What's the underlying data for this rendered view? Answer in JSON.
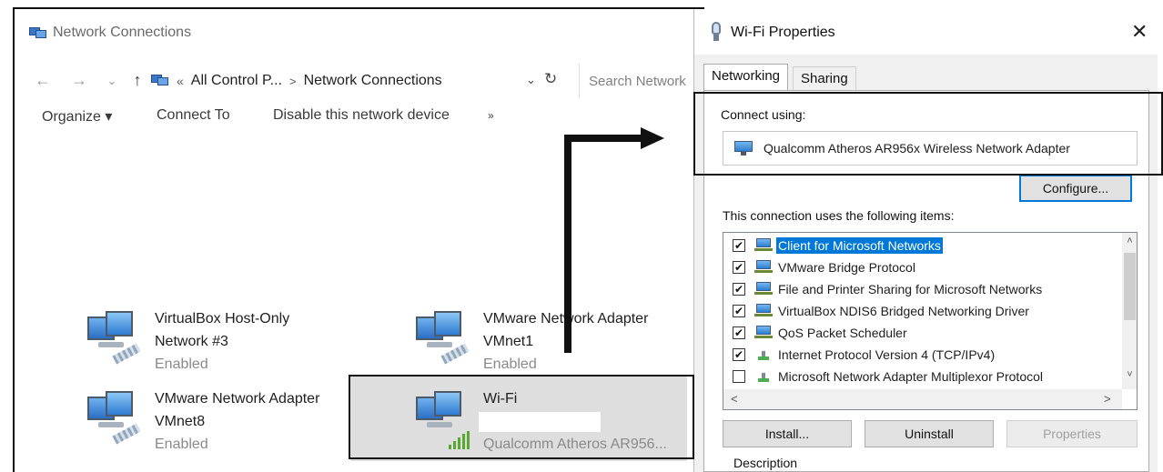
{
  "explorer": {
    "title": "Network Connections",
    "nav": {
      "back": "←",
      "forward": "→",
      "recent": "⌄",
      "up": "↑"
    },
    "address": {
      "overflow": "«",
      "crumb1": "All Control P...",
      "separator": ">",
      "crumb2": "Network Connections",
      "dropdown": "⌄",
      "refresh": "↻"
    },
    "search": {
      "placeholder": "Search Network"
    },
    "commands": {
      "organize": "Organize ▾",
      "connect_to": "Connect To",
      "disable": "Disable this network device",
      "more": "»"
    },
    "connections": [
      {
        "name_line1": "VirtualBox Host-Only",
        "name_line2": "Network #3",
        "status": "Enabled",
        "icon": "network-computer-icon"
      },
      {
        "name_line1": "VMware Network Adapter",
        "name_line2": "VMnet1",
        "status": "Enabled",
        "icon": "network-computer-icon"
      },
      {
        "name_line1": "VMware Network Adapter",
        "name_line2": "VMnet8",
        "status": "Enabled",
        "icon": "network-computer-icon"
      },
      {
        "name_line1": "Wi-Fi",
        "name_line2": "",
        "status": "Qualcomm Atheros AR956...",
        "icon": "wifi-computer-icon",
        "selected": true
      }
    ]
  },
  "dialog": {
    "title": "Wi-Fi Properties",
    "close": "✕",
    "tabs": [
      "Networking",
      "Sharing"
    ],
    "connect_using_label": "Connect using:",
    "adapter": "Qualcomm Atheros AR956x Wireless Network Adapter",
    "configure_button": "Configure...",
    "items_label": "This connection uses the following items:",
    "items": [
      {
        "label": "Client for Microsoft Networks",
        "checked": true,
        "selected": true,
        "icon": "network-client-icon"
      },
      {
        "label": "VMware Bridge Protocol",
        "checked": true,
        "icon": "network-client-icon"
      },
      {
        "label": "File and Printer Sharing for Microsoft Networks",
        "checked": true,
        "icon": "network-client-icon"
      },
      {
        "label": "VirtualBox NDIS6 Bridged Networking Driver",
        "checked": true,
        "icon": "network-client-icon"
      },
      {
        "label": "QoS Packet Scheduler",
        "checked": true,
        "icon": "network-client-icon"
      },
      {
        "label": "Internet Protocol Version 4 (TCP/IPv4)",
        "checked": true,
        "icon": "protocol-icon"
      },
      {
        "label": "Microsoft Network Adapter Multiplexor Protocol",
        "checked": false,
        "icon": "protocol-icon"
      }
    ],
    "check_mark": "✔",
    "scroll": {
      "up": "˄",
      "down": "˅",
      "left": "<",
      "right": ">"
    },
    "install_button": "Install...",
    "uninstall_button": "Uninstall",
    "properties_button": "Properties",
    "description_label": "Description"
  },
  "colors": {
    "selection": "#0078d7",
    "highlight": "#dedede",
    "annotation": "#111111"
  }
}
